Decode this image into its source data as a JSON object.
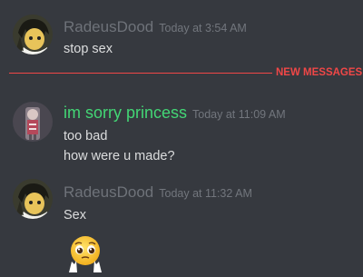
{
  "messages": [
    {
      "username": "RadeusDood",
      "timestamp": "Today at 3:54 AM",
      "lines": [
        "stop sex"
      ],
      "avatar_icon": "anime-character-avatar",
      "username_color": "#6e7279"
    },
    {
      "username": "im sorry princess",
      "timestamp": "Today at 11:09 AM",
      "lines": [
        "too bad",
        "how were u made?"
      ],
      "avatar_icon": "character-avatar",
      "username_color": "#43d675"
    },
    {
      "username": "RadeusDood",
      "timestamp": "Today at 11:32 AM",
      "lines": [
        "Sex"
      ],
      "avatar_icon": "anime-character-avatar",
      "username_color": "#6e7279",
      "emoji": "pleading-face-hands-emoji"
    }
  ],
  "divider": {
    "label": "NEW MESSAGES",
    "color": "#f04747"
  },
  "theme": {
    "background": "#36393f",
    "text": "#dcddde",
    "timestamp": "#72767d"
  }
}
